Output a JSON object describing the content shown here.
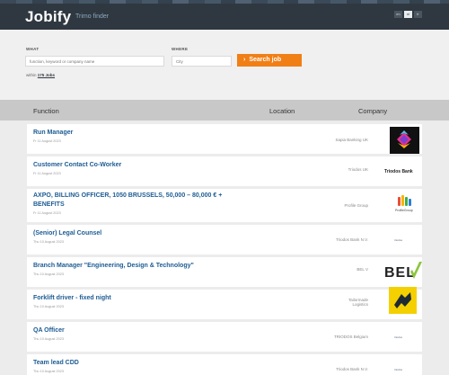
{
  "header": {
    "logo": "Jobify",
    "tagline": "Trimo finder",
    "languages": [
      "en",
      "nl",
      "fr"
    ],
    "active_language": "nl"
  },
  "search": {
    "what_label": "WHAT",
    "what_placeholder": "function, keyword or company name",
    "where_label": "WHERE",
    "where_placeholder": "City",
    "button_label": "Search job",
    "count_prefix": "within",
    "count_value": "175 Jobs"
  },
  "table": {
    "columns": [
      "Function",
      "Location",
      "Company"
    ]
  },
  "jobs": [
    {
      "title": "Run Manager",
      "date": "Fr 11 August 2023",
      "company": "Sapia Banking UK",
      "logo": "sapia-logo"
    },
    {
      "title": "Customer Contact Co-Worker",
      "date": "Fr 11 August 2023",
      "company": "Triodos UK",
      "logo": "triodos-logo",
      "logo_text": "Triodos Bank"
    },
    {
      "title_line1": "AXPO, BILLING OFFICER, 1050 BRUSSELS, 50,000 – 80,000 € +",
      "title_line2": "BENEFITS",
      "date": "Fr 11 August 2023",
      "company": "Profile Group",
      "logo": "profile-group-logo",
      "logo_text": "ProfileGroup"
    },
    {
      "title": "(Senior) Legal Counsel",
      "date": "Thu 10 August 2023",
      "company": "Triodos Bank N.V.",
      "logo": "triodos-small-logo",
      "logo_text": "triodos"
    },
    {
      "title": "Branch Manager \"Engineering, Design & Technology\"",
      "date": "Thu 10 August 2023",
      "company": "BEL V",
      "logo": "bel-v-logo",
      "logo_text": "BEL"
    },
    {
      "title": "Forklift driver - fixed night",
      "date": "Thu 10 August 2023",
      "company_line1": "Tailormade",
      "company_line2": "Logistics",
      "logo": "tailormade-logo"
    },
    {
      "title": "QA Officer",
      "date": "Thu 10 August 2023",
      "company": "TRIODOS Belgium",
      "logo": "triodos-belgium-logo",
      "logo_text": "triodos"
    },
    {
      "title": "Team lead CDD",
      "date": "Thu 10 August 2023",
      "company": "Triodos Bank N.V.",
      "logo": "triodos-bank-logo",
      "logo_text": "triodos"
    }
  ],
  "colors": {
    "header_bg": "#2f3840",
    "accent": "#f07f16",
    "link": "#1d5c94",
    "table_header_bg": "#c8c8c8"
  }
}
